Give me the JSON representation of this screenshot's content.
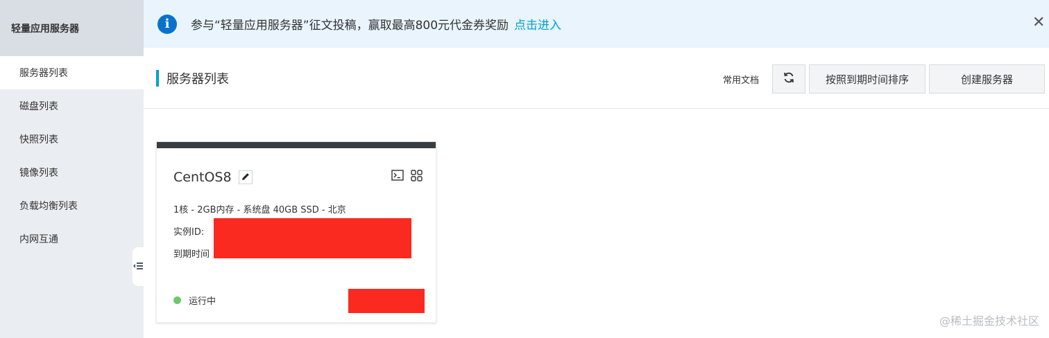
{
  "sidebar": {
    "title": "轻量应用服务器",
    "items": [
      {
        "label": "服务器列表",
        "active": true
      },
      {
        "label": "磁盘列表"
      },
      {
        "label": "快照列表"
      },
      {
        "label": "镜像列表"
      },
      {
        "label": "负载均衡列表"
      },
      {
        "label": "内网互通"
      }
    ]
  },
  "banner": {
    "icon": "info-icon",
    "text": "参与“轻量应用服务器”征文投稿，赢取最高800元代金券奖励",
    "link": "点击进入",
    "close": "✕"
  },
  "header": {
    "title": "服务器列表",
    "doc_link": "常用文档",
    "sort_button": "按照到期时间排序",
    "create_button": "创建服务器"
  },
  "card": {
    "name": "CentOS8",
    "spec": "1核 - 2GB内存 - 系统盘 40GB SSD - 北京",
    "instance_id_label": "实例ID:",
    "expire_label": "到期时间",
    "status": "运行中",
    "status_color": "#6dc86c",
    "redaction_color": "#fa2a20"
  },
  "watermark": "@稀土掘金技术社区",
  "colors": {
    "accent": "#00a2c9",
    "info": "#0a73c9",
    "banner_bg": "#e9f4fd",
    "sidebar_bg": "#eaedf1"
  }
}
